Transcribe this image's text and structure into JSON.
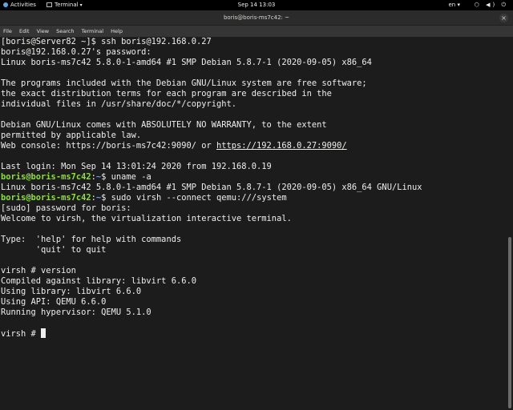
{
  "topbar": {
    "activities": "Activities",
    "app_name": "Terminal",
    "clock": "Sep 14  13:03",
    "lang": "en",
    "tray": "⬡ ◀) ⏻"
  },
  "window": {
    "title": "boris@boris-ms7c42: ~",
    "close_glyph": "×"
  },
  "menu": [
    "File",
    "Edit",
    "View",
    "Search",
    "Terminal",
    "Help"
  ],
  "terminal": {
    "lines": [
      {
        "t": "[boris@Server82 ~]$ ssh boris@192.168.0.27"
      },
      {
        "t": "boris@192.168.0.27's password:"
      },
      {
        "t": "Linux boris-ms7c42 5.8.0-1-amd64 #1 SMP Debian 5.8.7-1 (2020-09-05) x86_64"
      },
      {
        "t": ""
      },
      {
        "t": "The programs included with the Debian GNU/Linux system are free software;"
      },
      {
        "t": "the exact distribution terms for each program are described in the"
      },
      {
        "t": "individual files in /usr/share/doc/*/copyright."
      },
      {
        "t": ""
      },
      {
        "t": "Debian GNU/Linux comes with ABSOLUTELY NO WARRANTY, to the extent"
      },
      {
        "t": "permitted by applicable law."
      },
      {
        "t": "Web console: https://boris-ms7c42:9090/ or ",
        "link": "https://192.168.0.27:9090/"
      },
      {
        "t": ""
      },
      {
        "t": "Last login: Mon Sep 14 13:01:24 2020 from 192.168.0.19"
      },
      {
        "user": "boris@boris-ms7c42",
        "path": "~",
        "cmd": " uname -a"
      },
      {
        "t": "Linux boris-ms7c42 5.8.0-1-amd64 #1 SMP Debian 5.8.7-1 (2020-09-05) x86_64 GNU/Linux"
      },
      {
        "user": "boris@boris-ms7c42",
        "path": "~",
        "cmd": " sudo virsh --connect qemu:///system"
      },
      {
        "t": "[sudo] password for boris:"
      },
      {
        "t": "Welcome to virsh, the virtualization interactive terminal."
      },
      {
        "t": ""
      },
      {
        "t": "Type:  'help' for help with commands"
      },
      {
        "t": "       'quit' to quit"
      },
      {
        "t": ""
      },
      {
        "t": "virsh # version"
      },
      {
        "t": "Compiled against library: libvirt 6.6.0"
      },
      {
        "t": "Using library: libvirt 6.6.0"
      },
      {
        "t": "Using API: QEMU 6.6.0"
      },
      {
        "t": "Running hypervisor: QEMU 5.1.0"
      },
      {
        "t": ""
      },
      {
        "t": "virsh # ",
        "cursor": true
      }
    ]
  }
}
